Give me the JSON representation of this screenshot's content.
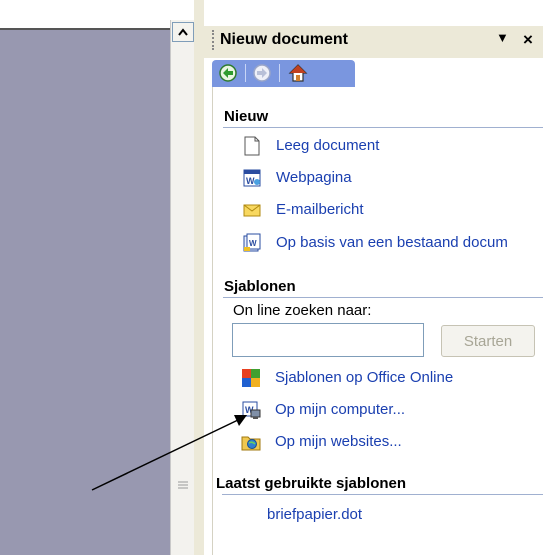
{
  "task_pane": {
    "title": "Nieuw document",
    "menu_icon": "dropdown-triangle-icon",
    "close_label": "×",
    "nav": [
      {
        "icon": "back-arrow-icon",
        "color": "#2e9b2e"
      },
      {
        "icon": "forward-arrow-icon",
        "color": "#ffffff"
      },
      {
        "icon": "home-icon",
        "color": "#ffffff"
      }
    ]
  },
  "sections": {
    "nieuw": {
      "title": "Nieuw",
      "items": [
        {
          "label": "Leeg document",
          "icon": "blank-document-icon"
        },
        {
          "label": "Webpagina",
          "icon": "web-page-icon"
        },
        {
          "label": "E-mailbericht",
          "icon": "envelope-icon"
        },
        {
          "label": "Op basis van een bestaand docum",
          "icon": "existing-document-icon"
        }
      ]
    },
    "sjablonen": {
      "title": "Sjablonen",
      "search_label": "On line zoeken naar:",
      "search_value": "",
      "start_button": "Starten",
      "items": [
        {
          "label": "Sjablonen op Office Online",
          "icon": "office-online-icon"
        },
        {
          "label": "Op mijn computer...",
          "icon": "computer-templates-icon"
        },
        {
          "label": "Op mijn websites...",
          "icon": "websites-icon"
        }
      ]
    },
    "recent": {
      "title": "Laatst gebruikte sjablonen",
      "items": [
        {
          "label": "briefpapier.dot"
        }
      ]
    }
  },
  "colors": {
    "link": "#1a3fb0",
    "nav_bar": "#7a96df",
    "doc_area": "#9898b0",
    "pane_header": "#ece9d8"
  }
}
